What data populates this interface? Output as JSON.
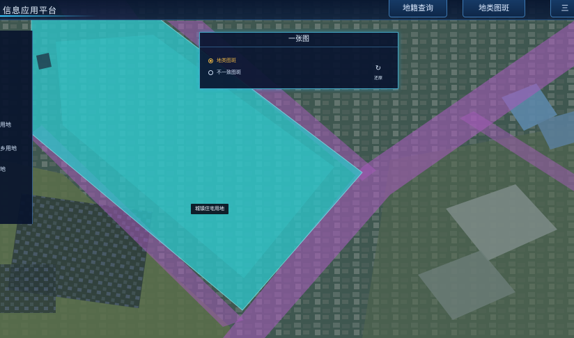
{
  "header": {
    "app_title": "信息应用平台",
    "tabs": [
      {
        "label": "地籍查询"
      },
      {
        "label": "地类图斑"
      },
      {
        "label": "三"
      }
    ]
  },
  "sidebar": {
    "items": [
      {
        "label": "用地"
      },
      {
        "label": "乡用地"
      },
      {
        "label": "地"
      }
    ]
  },
  "panel": {
    "title": "一张图",
    "options": [
      {
        "label": "地类图斑",
        "selected": true
      },
      {
        "label": "不一致图斑",
        "selected": false
      }
    ],
    "reset_label": "还原"
  },
  "map": {
    "parcel_label": "城镇住宅用地",
    "colors": {
      "highlight_parcel": "#2ec4c9",
      "road_overlay": "#b260c9",
      "accent": "#38c8ff",
      "selected_radio": "#e8b347"
    }
  }
}
